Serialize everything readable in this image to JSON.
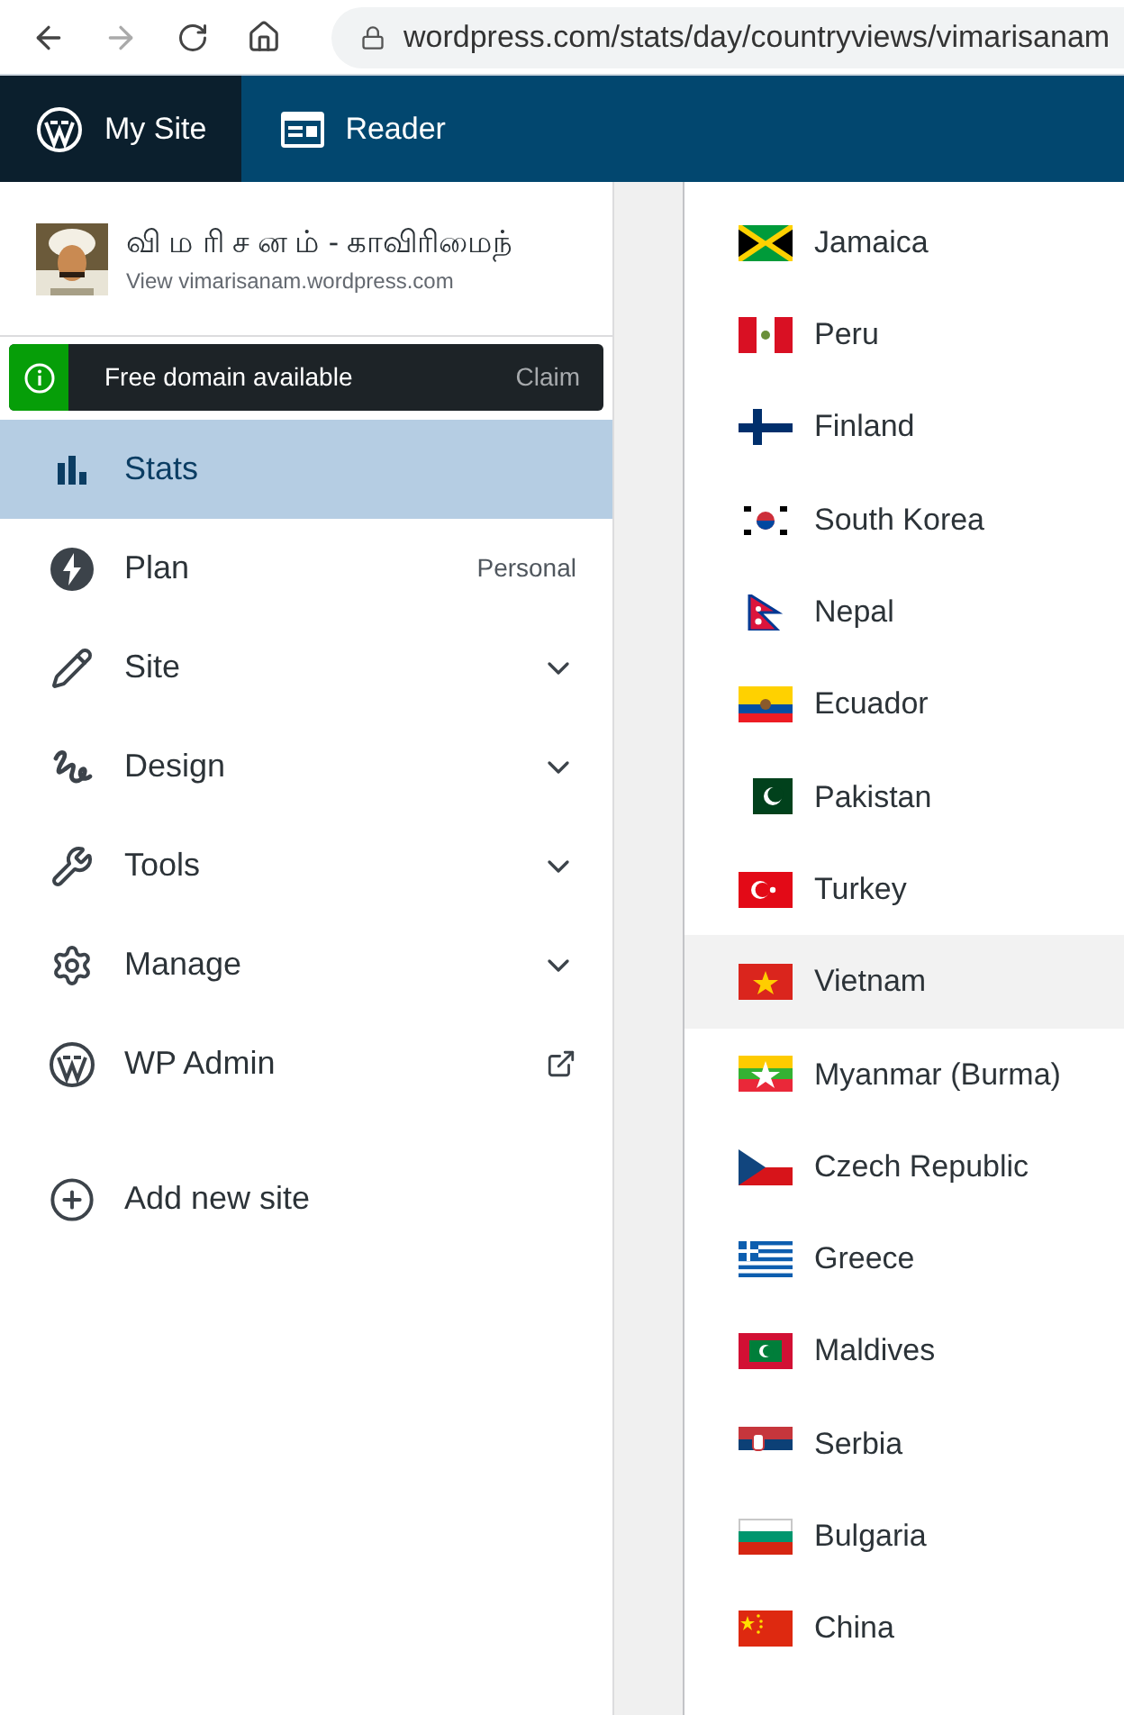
{
  "browser": {
    "url": "wordpress.com/stats/day/countryviews/vimarisanam"
  },
  "masterbar": [
    {
      "label": "My Site",
      "selected": true,
      "kind": "wp"
    },
    {
      "label": "Reader",
      "selected": false,
      "kind": "reader"
    }
  ],
  "site": {
    "title": "வி ம ரி ச ன ம் - காவிரிமைந்",
    "url": "View vimarisanam.wordpress.com"
  },
  "notice": {
    "text": "Free domain available",
    "action": "Claim"
  },
  "sidebar": {
    "items": [
      {
        "label": "Stats",
        "kind": "stats",
        "selected": true
      },
      {
        "label": "Plan",
        "kind": "plan",
        "selected": false,
        "badge": "Personal"
      },
      {
        "label": "Site",
        "kind": "site",
        "selected": false,
        "expanded": false
      },
      {
        "label": "Design",
        "kind": "design",
        "selected": false,
        "expanded": false
      },
      {
        "label": "Tools",
        "kind": "tools",
        "selected": false,
        "expanded": false
      },
      {
        "label": "Manage",
        "kind": "manage",
        "selected": false,
        "expanded": false
      },
      {
        "label": "WP Admin",
        "kind": "wp",
        "selected": false,
        "external": true
      }
    ],
    "add_site": "Add new site"
  },
  "countries": [
    {
      "name": "Jamaica",
      "selected": false
    },
    {
      "name": "Peru",
      "selected": false
    },
    {
      "name": "Finland",
      "selected": false
    },
    {
      "name": "South Korea",
      "selected": false
    },
    {
      "name": "Nepal",
      "selected": false
    },
    {
      "name": "Ecuador",
      "selected": false
    },
    {
      "name": "Pakistan",
      "selected": false
    },
    {
      "name": "Turkey",
      "selected": false
    },
    {
      "name": "Vietnam",
      "selected": true
    },
    {
      "name": "Myanmar (Burma)",
      "selected": false
    },
    {
      "name": "Czech Republic",
      "selected": false
    },
    {
      "name": "Greece",
      "selected": false
    },
    {
      "name": "Maldives",
      "selected": false
    },
    {
      "name": "Serbia",
      "selected": false
    },
    {
      "name": "Bulgaria",
      "selected": false
    },
    {
      "name": "China",
      "selected": false
    }
  ]
}
